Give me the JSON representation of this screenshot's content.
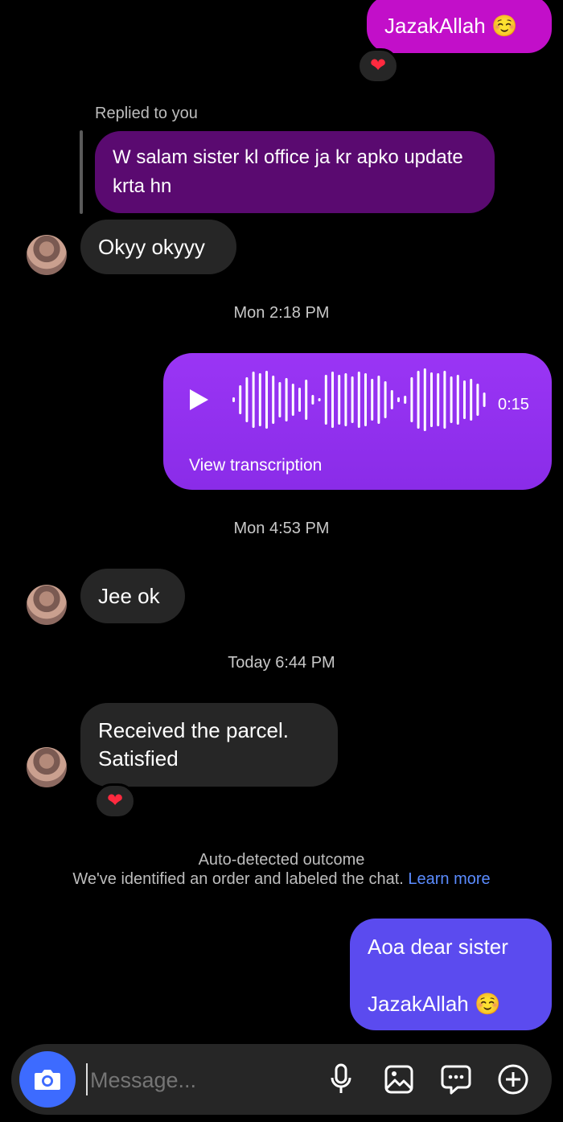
{
  "messages": {
    "top_outgoing": "JazakAllah ☺️",
    "reply_label": "Replied to you",
    "quoted_text": "W salam sister kl office ja kr apko update krta hn",
    "msg_okyy": "Okyy okyyy",
    "ts1": "Mon 2:18 PM",
    "voice_duration": "0:15",
    "view_transcription": "View transcription",
    "ts2": "Mon 4:53 PM",
    "msg_jee": "Jee ok",
    "ts3": "Today 6:44 PM",
    "msg_received": "Received the parcel. Satisfied",
    "outcome_title": "Auto-detected outcome",
    "outcome_text": "We've identified an order and labeled the chat.",
    "learn_more": "Learn more",
    "last_outgoing_line1": "Aoa dear sister",
    "last_outgoing_line2": "JazakAllah ☺️"
  },
  "composer": {
    "placeholder": "Message..."
  },
  "colors": {
    "outgoing_magenta": "#c20fc9",
    "quoted_purple": "#5a0a70",
    "voice_purple": "#8d2ef0",
    "outgoing_blue": "#5b4bef",
    "incoming_gray": "#262626",
    "link_blue": "#5b8cff"
  },
  "icons": [
    "heart-icon",
    "play-icon",
    "camera-icon",
    "microphone-icon",
    "gallery-icon",
    "sticker-icon",
    "plus-icon"
  ]
}
